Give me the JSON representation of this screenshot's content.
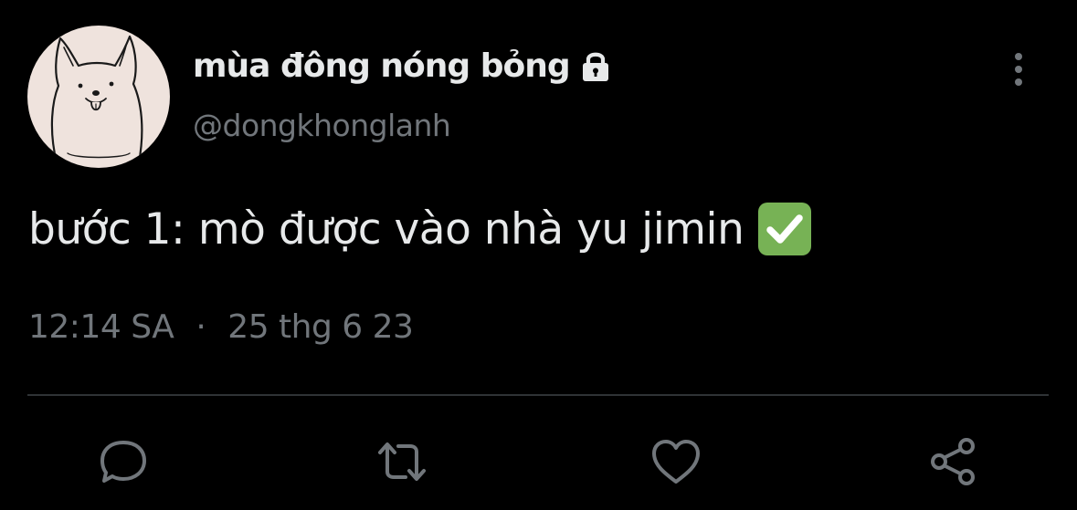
{
  "tweet": {
    "author": {
      "display_name": "mùa đông nóng bỏng",
      "handle": "@dongkhonglanh",
      "protected_icon": "lock-icon",
      "avatar_icon": "dog-doodle-avatar"
    },
    "text": "bước 1: mò được vào nhà yu jimin",
    "emoji": "check-mark-button-emoji",
    "time": "12:14 SA",
    "separator": "·",
    "date": "25 thg 6 23"
  },
  "actions": [
    {
      "name": "reply",
      "icon": "comment-icon"
    },
    {
      "name": "retweet",
      "icon": "retweet-icon"
    },
    {
      "name": "like",
      "icon": "heart-icon"
    },
    {
      "name": "share",
      "icon": "share-icon"
    }
  ],
  "colors": {
    "background": "#000000",
    "primary_text": "#e7e9ea",
    "secondary_text": "#71767b",
    "divider": "#2f3336",
    "check_green": "#77b255",
    "avatar_bg": "#efe3dd"
  }
}
